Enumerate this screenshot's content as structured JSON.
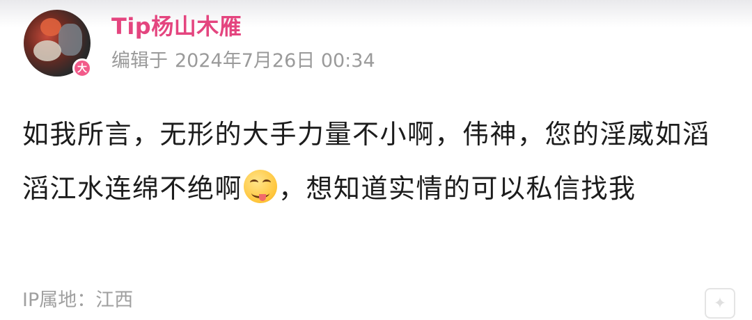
{
  "author": {
    "name": "Tip杨山木雁",
    "badge": "大",
    "avatar": "user-avatar"
  },
  "meta": {
    "edit_prefix": "编辑于",
    "edit_datetime": "2024年7月26日 00:34"
  },
  "post": {
    "text_part1": "如我所言，无形的大手力量不小啊，伟神，您的淫威如滔滔江水连绵不绝啊",
    "emoji": "grinning-tongue-emoji",
    "text_part2": "，想知道实情的可以私信找我"
  },
  "footer": {
    "ip_location": "IP属地：江西"
  },
  "colors": {
    "username": "#e4457f",
    "badge": "#f25b8a",
    "meta_text": "#9a9a9a",
    "body_text": "#1c1c1c"
  }
}
